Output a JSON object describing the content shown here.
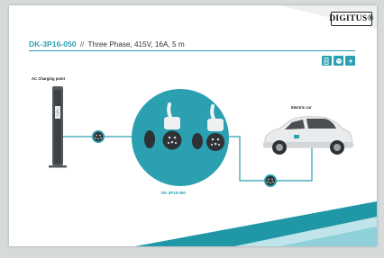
{
  "brand": {
    "logo_text": "DIGITUS®"
  },
  "header": {
    "model_code": "DK-3P16-050",
    "separator": "//",
    "description": "Three Phase, 415V, 16A, 5 m"
  },
  "badges": [
    {
      "icon": "charger-icon"
    },
    {
      "icon": "round-plug-icon"
    },
    {
      "icon": "power-bolt-icon"
    }
  ],
  "diagram": {
    "charging_point_label": "AC Charging point",
    "product_label": "DK-3P16-050",
    "car_label": "Electric car"
  },
  "colors": {
    "accent": "#2aa0b1",
    "connector_dark": "#2f3234",
    "teal_stripe": "#1f97a6"
  }
}
